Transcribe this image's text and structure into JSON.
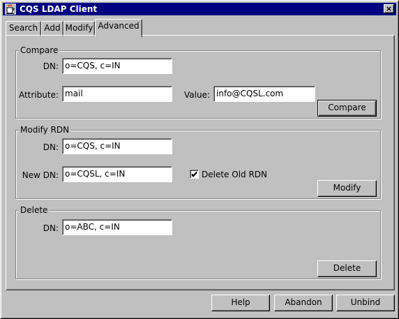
{
  "window": {
    "title": "CQS LDAP Client",
    "close_glyph": "×"
  },
  "tabs": [
    {
      "label": "Search",
      "active": false
    },
    {
      "label": "Add",
      "active": false
    },
    {
      "label": "Modify",
      "active": false
    },
    {
      "label": "Advanced",
      "active": true
    }
  ],
  "compare": {
    "group_label": "Compare",
    "dn_label": "DN:",
    "dn_value": "o=CQS, c=IN",
    "attribute_label": "Attribute:",
    "attribute_value": "mail",
    "value_label": "Value:",
    "value_value": "info@CQSL.com",
    "button_label": "Compare"
  },
  "modify_rdn": {
    "group_label": "Modify RDN",
    "dn_label": "DN:",
    "dn_value": "o=CQS, c=IN",
    "new_dn_label": "New DN:",
    "new_dn_value": "o=CQSL, c=IN",
    "delete_old_rdn_label": "Delete Old RDN",
    "delete_old_rdn_checked": true,
    "button_label": "Modify"
  },
  "delete": {
    "group_label": "Delete",
    "dn_label": "DN:",
    "dn_value": "o=ABC, c=IN",
    "button_label": "Delete"
  },
  "footer": {
    "help_label": "Help",
    "abandon_label": "Abandon",
    "unbind_label": "Unbind"
  },
  "colors": {
    "titlebar": "#000080",
    "face": "#c0c0c0"
  },
  "icons": {
    "app": "coffee-cup-icon",
    "close": "close-icon",
    "check": "checkmark-icon"
  }
}
